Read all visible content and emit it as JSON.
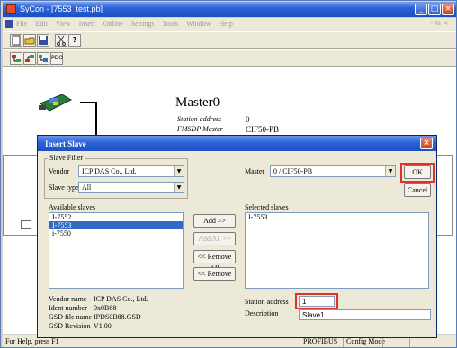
{
  "window": {
    "title": "SyCon - [7553_test.pb]"
  },
  "menubar": {
    "items": [
      "File",
      "Edit",
      "View",
      "Insert",
      "Online",
      "Settings",
      "Tools",
      "Window",
      "Help"
    ],
    "right": "- ⧉ ×"
  },
  "toolbar1": {
    "buttons": [
      "new",
      "open",
      "save",
      "cut",
      "help"
    ]
  },
  "toolbar2": {
    "buttons": [
      "insert-master",
      "insert-slave",
      "slave-bus",
      "pdo"
    ],
    "pdo_label": "PDO"
  },
  "workspace": {
    "master_title": "Master0",
    "station_address_label": "Station address",
    "station_address_value": "0",
    "fmsdp_label": "FMSDP Master",
    "fmsdp_value": "CIF50-PB"
  },
  "dialog": {
    "title": "Insert Slave",
    "slave_filter_label": "Slave Filter",
    "vendor_label": "Vendor",
    "vendor_value": "ICP DAS Co., Ltd.",
    "slave_type_label": "Slave type",
    "slave_type_value": "All",
    "master_label": "Master",
    "master_value": "0 / CIF50-PB",
    "ok_label": "OK",
    "cancel_label": "Cancel",
    "available_label": "Available slaves",
    "available_items": [
      "I-7552",
      "I-7553",
      "i-7550"
    ],
    "available_selected_index": 1,
    "selected_label": "Selected slaves",
    "selected_items": [
      "I-7553"
    ],
    "add_label": "Add >>",
    "add_all_label": "Add All >>",
    "remove_all_label": "<< Remove All",
    "remove_label": "<< Remove",
    "info": [
      {
        "label": "Vendor name",
        "value": "ICP DAS Co., Ltd."
      },
      {
        "label": "Ident number",
        "value": "0x0B88"
      },
      {
        "label": "GSD file name",
        "value": "IPDS0B88.GSD"
      },
      {
        "label": "GSD Revision",
        "value": "V1.00"
      }
    ],
    "station_address_label": "Station address",
    "station_address_value": "1",
    "description_label": "Description",
    "description_value": "Slave1"
  },
  "statusbar": {
    "help": "For Help, press F1",
    "cells": [
      "PROFIBUS",
      "Config Mode"
    ]
  },
  "colors": {
    "title_blue": "#2a63d8",
    "highlight_red": "#e03030",
    "selection_blue": "#316ac5"
  }
}
